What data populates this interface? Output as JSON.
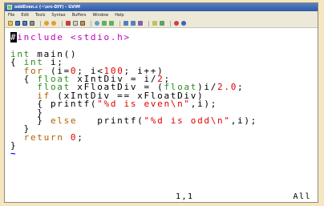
{
  "window": {
    "title": "oddEven.c (~\\src-DIY) - GVIM"
  },
  "menubar": {
    "items": [
      "File",
      "Edit",
      "Tools",
      "Syntax",
      "Buffers",
      "Window",
      "Help"
    ]
  },
  "toolbar": {
    "buttons": [
      "open-icon",
      "save-icon",
      "save-all-icon",
      "print-icon",
      "undo-icon",
      "redo-icon",
      "cut-icon",
      "copy-icon",
      "paste-icon",
      "find-icon",
      "find-next-icon",
      "find-prev-icon",
      "load-session-icon",
      "save-session-icon",
      "run-script-icon",
      "make-icon",
      "ctags-icon",
      "help-icon",
      "find-help-icon"
    ]
  },
  "code": {
    "l1": {
      "cursor": "#",
      "include": "include",
      "header": "<stdio.h>"
    },
    "l3": {
      "type": "int",
      "rest": "main()"
    },
    "l4": {
      "brace": "{",
      "type": "int",
      "rest": "i;"
    },
    "l5": {
      "kw": "for",
      "a": "(i=",
      "n1": "0",
      "b": "; i<",
      "n2": "100",
      "c": "; i++)"
    },
    "l6": {
      "brace": "{",
      "type": "float",
      "rest": "xIntDiv = i/",
      "n": "2",
      "end": ";"
    },
    "l7": {
      "type1": "float",
      "mid": "xFloatDiv = (",
      "type2": "float",
      "rest": ")i/",
      "n": "2.0",
      "end": ";"
    },
    "l8": {
      "kw": "if",
      "rest": "(xIntDiv == xFloatDiv)"
    },
    "l9": {
      "brace": "{",
      "fn": "printf(",
      "str": "\"%d is even\\n\"",
      "end": ",i);"
    },
    "l10": {
      "brace": "}"
    },
    "l11": {
      "brace": "}",
      "kw": "else",
      "fn": "printf(",
      "str": "\"%d is odd\\n\"",
      "end": ",i);"
    },
    "l12": {
      "brace": "}"
    },
    "l13": {
      "kw": "return",
      "n": "0",
      "end": ";"
    },
    "l14": {
      "brace": "}"
    },
    "l15": {
      "tilde": "~"
    }
  },
  "status": {
    "position": "1,1",
    "scroll": "All"
  },
  "colors": {
    "preprocessor": "#c000c0",
    "type": "#2e8b20",
    "statement": "#b06000",
    "constant": "#e00000"
  }
}
